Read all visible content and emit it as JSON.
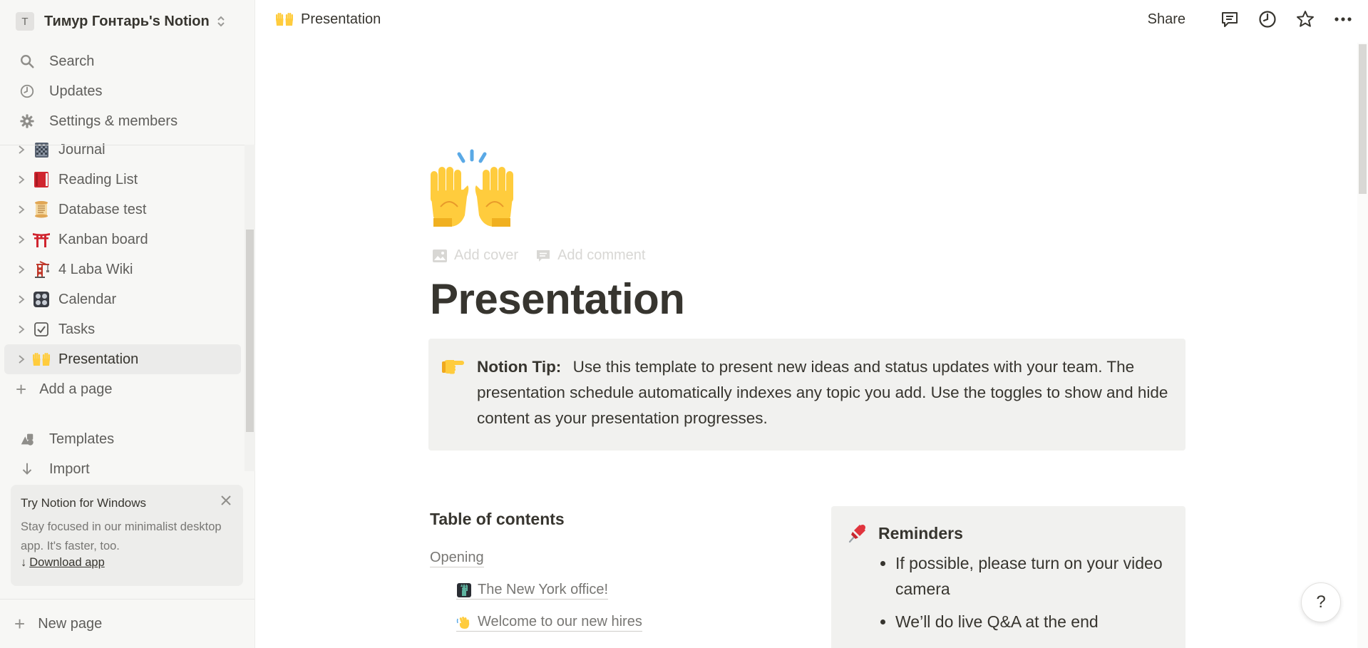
{
  "workspace": {
    "avatar_letter": "T",
    "name": "Тимур Гонтарь's Notion"
  },
  "sidebar": {
    "top_nav": [
      {
        "label": "Search",
        "icon": "search-icon"
      },
      {
        "label": "Updates",
        "icon": "clock-icon"
      },
      {
        "label": "Settings & members",
        "icon": "gear-icon"
      }
    ],
    "pages": [
      {
        "label": "Journal",
        "icon": "notebook-icon"
      },
      {
        "label": "Reading List",
        "icon": "red-book-icon"
      },
      {
        "label": "Database test",
        "icon": "scroll-icon"
      },
      {
        "label": "Kanban board",
        "icon": "torii-gate-icon"
      },
      {
        "label": "4 Laba Wiki",
        "icon": "crane-icon"
      },
      {
        "label": "Calendar",
        "icon": "control-knobs-icon"
      },
      {
        "label": "Tasks",
        "icon": "checkbox-icon"
      },
      {
        "label": "Presentation",
        "icon": "raised-hands-icon",
        "active": true
      }
    ],
    "add_page": "Add a page",
    "bottom_links": [
      {
        "label": "Templates",
        "icon": "shapes-icon"
      },
      {
        "label": "Import",
        "icon": "arrow-down-icon"
      }
    ],
    "promo": {
      "title": "Try Notion for Windows",
      "body": "Stay focused in our minimalist desktop app. It's faster, too.",
      "link": "Download app"
    },
    "new_page": "New page"
  },
  "topbar": {
    "breadcrumb": "Presentation",
    "share": "Share"
  },
  "page": {
    "add_cover": "Add cover",
    "add_comment": "Add comment",
    "title": "Presentation",
    "callout": {
      "label": "Notion Tip:",
      "text": "Use this template to present new ideas and status updates with your team. The presentation schedule automatically indexes any topic you add. Use the toggles to show and hide content as your presentation progresses."
    },
    "toc": {
      "heading": "Table of contents",
      "items": [
        {
          "label": "Opening"
        },
        {
          "label": "The New York office!"
        },
        {
          "label": "Welcome to our new hires"
        }
      ]
    },
    "reminders": {
      "heading": "Reminders",
      "items": [
        "If possible, please turn on your video camera",
        "We’ll do live Q&A at the end"
      ]
    },
    "help": "?"
  },
  "colors": {
    "sidebar_bg": "#f7f7f5",
    "text": "#37352f",
    "muted": "#787774",
    "callout_bg": "#f1f1ef",
    "active_bg": "#ebebea"
  }
}
